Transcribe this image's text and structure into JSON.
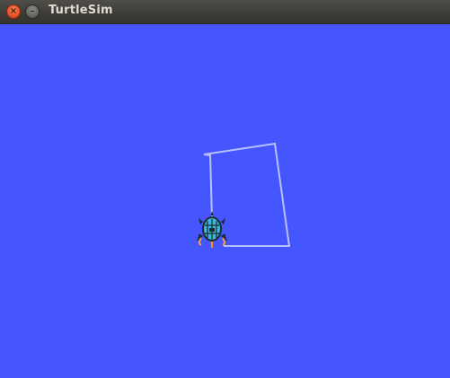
{
  "window": {
    "title": "TurtleSim",
    "close_glyph": "×",
    "minimize_glyph": "–"
  },
  "canvas": {
    "background_color": "#4556ff",
    "pen_color": "#b9c0ff"
  },
  "turtle": {
    "icon": "turtle-icon",
    "heading": "down"
  }
}
